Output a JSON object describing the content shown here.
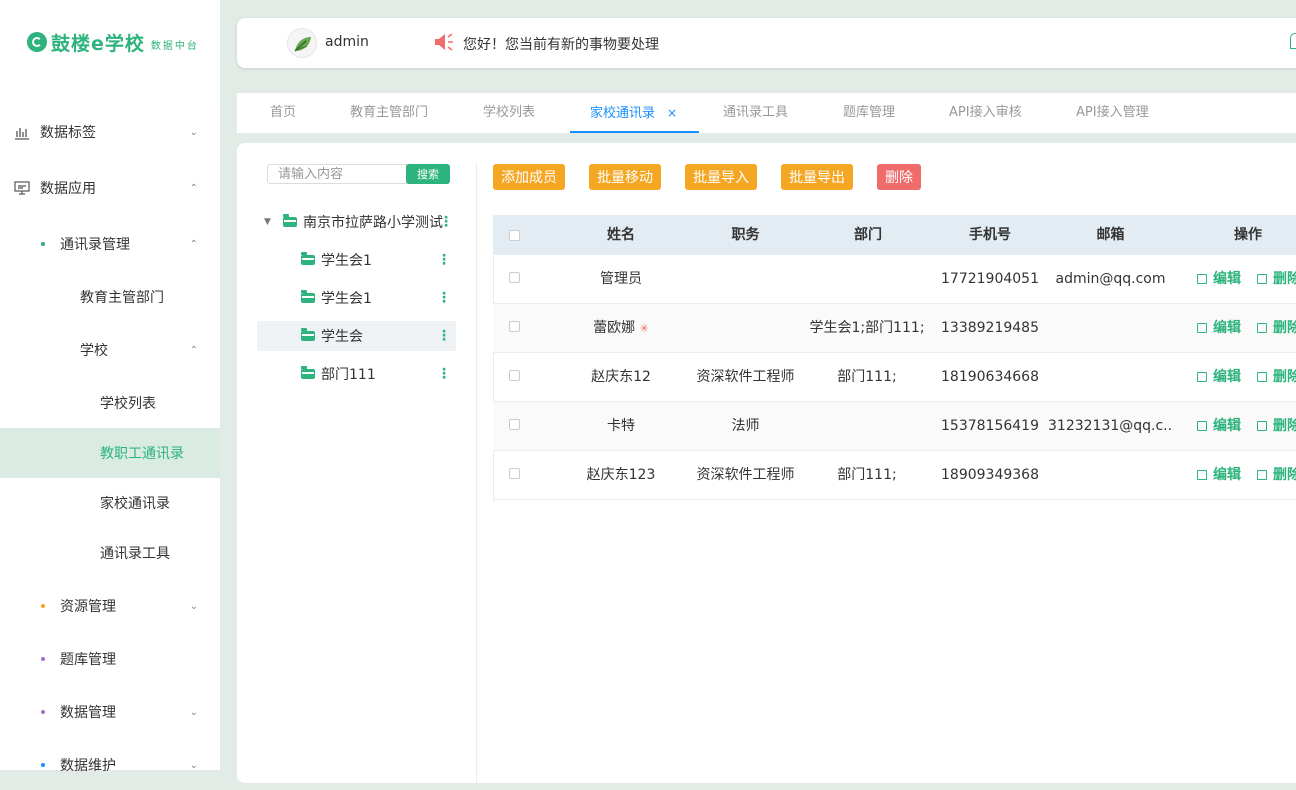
{
  "brand": {
    "name": "鼓楼e学校",
    "sub": "数据中台",
    "color": "#2db37d"
  },
  "sidebar": {
    "items": [
      {
        "label": "数据标签",
        "icon": "bar-chart-icon",
        "chevron": "down"
      },
      {
        "label": "数据应用",
        "icon": "monitor-icon",
        "chevron": "up"
      },
      {
        "label": "通讯录管理",
        "dot": "#2db37d",
        "chevron": "up"
      },
      {
        "label": "教育主管部门"
      },
      {
        "label": "学校",
        "chevron": "up"
      },
      {
        "label": "学校列表"
      },
      {
        "label": "教职工通讯录",
        "active": true
      },
      {
        "label": "家校通讯录"
      },
      {
        "label": "通讯录工具"
      },
      {
        "label": "资源管理",
        "dot": "#f5a623",
        "chevron": "down"
      },
      {
        "label": "题库管理",
        "dot": "#a66bd4"
      },
      {
        "label": "数据管理",
        "dot": "#a66bd4",
        "chevron": "down"
      },
      {
        "label": "数据维护",
        "dot": "#1890ff",
        "chevron": "down"
      }
    ]
  },
  "header": {
    "username": "admin",
    "notice": "您好！您当前有新的事物要处理"
  },
  "tabs": [
    {
      "label": "首页"
    },
    {
      "label": "教育主管部门"
    },
    {
      "label": "学校列表"
    },
    {
      "label": "家校通讯录",
      "active": true,
      "close": "×"
    },
    {
      "label": "通讯录工具"
    },
    {
      "label": "题库管理"
    },
    {
      "label": "API接入审核"
    },
    {
      "label": "API接入管理"
    }
  ],
  "search": {
    "placeholder": "请输入内容",
    "button": "搜索"
  },
  "tree": {
    "root": "南京市拉萨路小学测试",
    "children": [
      {
        "label": "学生会1"
      },
      {
        "label": "学生会1"
      },
      {
        "label": "学生会",
        "selected": true
      },
      {
        "label": "部门111"
      }
    ]
  },
  "toolbar": {
    "add": "添加成员",
    "batch_move": "批量移动",
    "batch_import": "批量导入",
    "batch_export": "批量导出",
    "delete": "删除"
  },
  "table": {
    "headers": [
      "姓名",
      "职务",
      "部门",
      "手机号",
      "邮箱",
      "操作"
    ],
    "rows": [
      {
        "name": "管理员",
        "title": "",
        "dept": "",
        "phone": "17721904051",
        "email": "admin@qq.com"
      },
      {
        "name": "蕾欧娜",
        "title": "",
        "dept": "学生会1;部门111;",
        "phone": "13389219485",
        "email": "",
        "badge": "org-icon"
      },
      {
        "name": "赵庆东12",
        "title": "资深软件工程师",
        "dept": "部门111;",
        "phone": "18190634668",
        "email": ""
      },
      {
        "name": "卡特",
        "title": "法师",
        "dept": "",
        "phone": "15378156419",
        "email": "31232131@qq.c..."
      },
      {
        "name": "赵庆东123",
        "title": "资深软件工程师",
        "dept": "部门111;",
        "phone": "18909349368",
        "email": ""
      }
    ],
    "edit_label": "编辑",
    "delete_label": "删除"
  }
}
